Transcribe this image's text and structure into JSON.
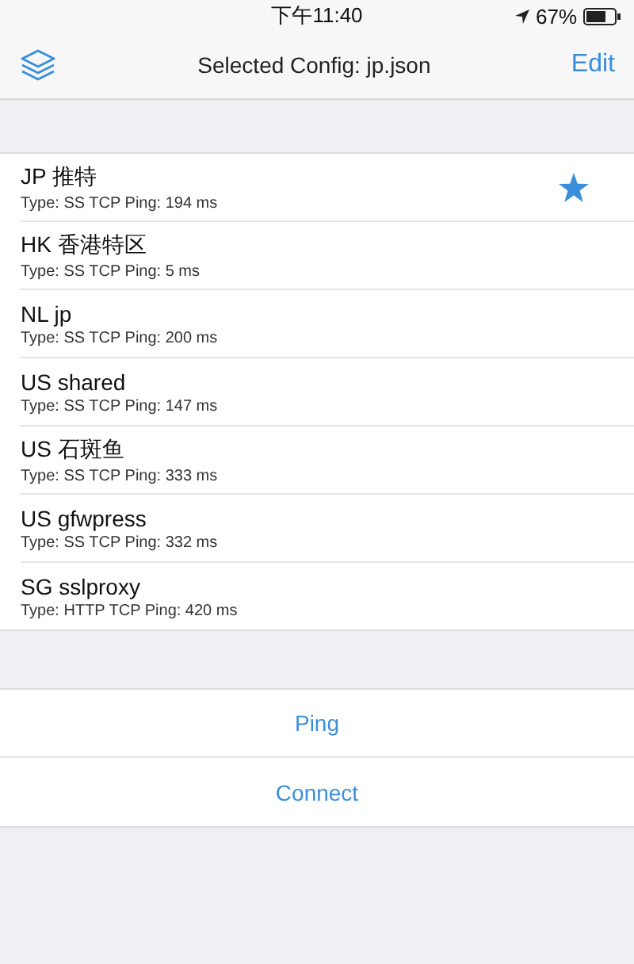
{
  "status_bar": {
    "time": "下午11:40",
    "battery": "67%"
  },
  "nav_bar": {
    "title": "Selected Config: jp.json",
    "edit": "Edit"
  },
  "servers": [
    {
      "name": "JP 推特",
      "detail": "Type: SS TCP Ping: 194 ms",
      "selected": true
    },
    {
      "name": "HK 香港特区",
      "detail": "Type: SS TCP Ping: 5 ms",
      "selected": false
    },
    {
      "name": "NL jp",
      "detail": "Type: SS TCP Ping: 200 ms",
      "selected": false
    },
    {
      "name": "US shared",
      "detail": "Type: SS TCP Ping: 147 ms",
      "selected": false
    },
    {
      "name": "US 石斑鱼",
      "detail": "Type: SS TCP Ping: 333 ms",
      "selected": false
    },
    {
      "name": "US gfwpress",
      "detail": "Type: SS TCP Ping: 332 ms",
      "selected": false
    },
    {
      "name": "SG sslproxy",
      "detail": "Type: HTTP TCP Ping: 420 ms",
      "selected": false
    }
  ],
  "actions": [
    "Ping",
    "Connect"
  ]
}
